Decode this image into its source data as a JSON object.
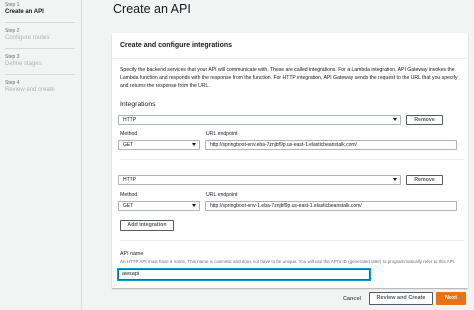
{
  "steps": [
    {
      "num": "Step 1",
      "name": "Create an API"
    },
    {
      "num": "Step 2",
      "name": "Configure routes"
    },
    {
      "num": "Step 3",
      "name": "Define stages"
    },
    {
      "num": "Step 4",
      "name": "Review and create"
    }
  ],
  "title": "Create an API",
  "panel": {
    "title": "Create and configure integrations",
    "description": "Specify the backend services that your API will communicate with. These are called integrations. For a Lambda integration, API Gateway invokes the Lambda function and responds with the response from the function. For HTTP integration, API Gateway sends the request to the URL that you specify and returns the response from the URL."
  },
  "integrations": {
    "label": "Integrations",
    "items": [
      {
        "type": "HTTP",
        "remove_label": "Remove",
        "method_label": "Method",
        "method": "GET",
        "url_label": "URL endpoint",
        "url": "http://springboot-env.eba-7znjbf9p.us-east-1.elasticbeanstalk.com/"
      },
      {
        "type": "HTTP",
        "remove_label": "Remove",
        "method_label": "Method",
        "method": "GET",
        "url_label": "URL endpoint",
        "url": "http://springboot-env-1.eba-7znjbf9p.us-east-1.elasticbeanstalk.com/"
      }
    ],
    "add_label": "Add integration"
  },
  "api_name": {
    "label": "API name",
    "hint": "An HTTP API must have a name. This name is cosmetic and does not have to be unique. You will use the API's ID (generated later) to programmatically refer to this API.",
    "value": "awsapi"
  },
  "footer": {
    "cancel": "Cancel",
    "review": "Review and Create",
    "next": "Next"
  },
  "colors": {
    "primary": "#ec7211",
    "focus": "#0073bb"
  }
}
